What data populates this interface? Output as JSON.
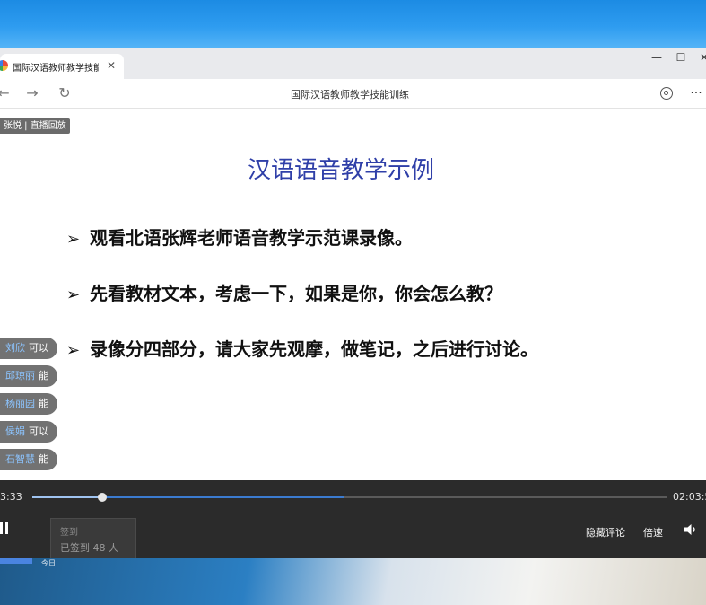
{
  "browser": {
    "tab_title": "国际汉语教师教学技能",
    "tab_close": "✕",
    "window_minimize": "—",
    "window_maximize": "☐",
    "window_close": "✕",
    "page_title": "国际汉语教师教学技能训练",
    "back": "←",
    "forward": "→",
    "reload": "↻",
    "more": "···"
  },
  "live": {
    "host_badge": "张悦 | 直播回放"
  },
  "slide": {
    "title": "汉语语音教学示例",
    "bullets": [
      "观看北语张辉老师语音教学示范课录像。",
      "先看教材文本，考虑一下，如果是你，你会怎么教？",
      "录像分四部分，请大家先观摩，做笔记，之后进行讨论。"
    ],
    "bullet_marker": "➢"
  },
  "comments": [
    {
      "name": "刘欣",
      "text": "可以"
    },
    {
      "name": "邱琼丽",
      "text": "能"
    },
    {
      "name": "杨丽园",
      "text": "能"
    },
    {
      "name": "侯娟",
      "text": "可以"
    },
    {
      "name": "石智慧",
      "text": "能"
    }
  ],
  "player": {
    "current_time": "3:33",
    "total_time": "02:03:5",
    "progress": 0.11,
    "buffered": 0.49,
    "signin_label": "签到",
    "signin_count": "已签到 48 人",
    "hide_comments": "隐藏评论",
    "speed": "倍速"
  },
  "taskbar": {
    "label": "今日"
  },
  "colors": {
    "slide_title": "#2f3fa8",
    "player_bg": "#2b2b2b",
    "progress_buffer": "#3b7bd0",
    "comment_name": "#8cc4ff"
  }
}
